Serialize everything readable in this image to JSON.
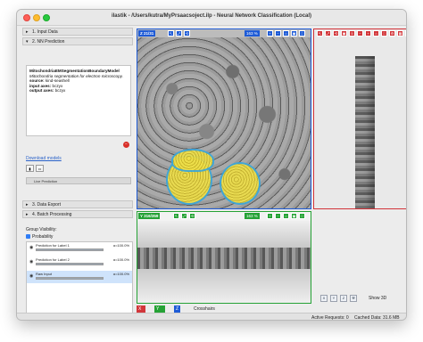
{
  "window": {
    "title": "ilastik - /Users/kutra/MyPrsaacsoject.ilp - Neural Network Classification (Local)"
  },
  "applets": [
    {
      "label": "1. Input Data",
      "arrow": "▸"
    },
    {
      "label": "2. NN Prediction",
      "arrow": "▾"
    },
    {
      "label": "3. Data Export",
      "arrow": "▸"
    },
    {
      "label": "4. Batch Processing",
      "arrow": "▸"
    }
  ],
  "model_info": {
    "name": "MitochondriaEMSegmentationBoundaryModel",
    "description": "Mitochondria segmentation for electron microscopy.",
    "source_label": "source:",
    "source_value": "kind-seashell",
    "input_axes_label": "input axes:",
    "input_axes_value": "bczyx",
    "output_axes_label": "output axes:",
    "output_axes_value": "bczyx"
  },
  "download_link": "Download models",
  "live_prediction": "Live Prediction",
  "group_visibility": "Group Visibility:",
  "probability_label": "Probability",
  "layers": [
    {
      "name": "Prediction for Label 1",
      "alpha": "α=100.0%",
      "fill": 1.0,
      "selected": false
    },
    {
      "name": "Prediction for Label 2",
      "alpha": "α=100.0%",
      "fill": 1.0,
      "selected": false
    },
    {
      "name": "Raw Input",
      "alpha": "α=100.0%",
      "fill": 1.0,
      "selected": true
    }
  ],
  "views": {
    "xy": {
      "slice": "Z 21/31",
      "zoom": "163 %"
    },
    "side": {
      "slice": "5",
      "zoom": "163 %"
    },
    "xz": {
      "slice": "Y 316/359",
      "zoom": "163 %"
    }
  },
  "coords": {
    "x_label": "X",
    "x_val": "97",
    "y_label": "Y",
    "y_val": "316",
    "z_label": "Z",
    "z_val": "0"
  },
  "crosshairs": "Crosshairs",
  "show3d": "Show 3D",
  "status": {
    "active_requests": "Active Requests: 0",
    "cached_data": "Cached Data: 31.6 MB"
  },
  "colors": {
    "x_axis": "#d2363a",
    "y_axis": "#25a235",
    "z_axis": "#1e5bd6",
    "mito": "#e6d23a"
  }
}
